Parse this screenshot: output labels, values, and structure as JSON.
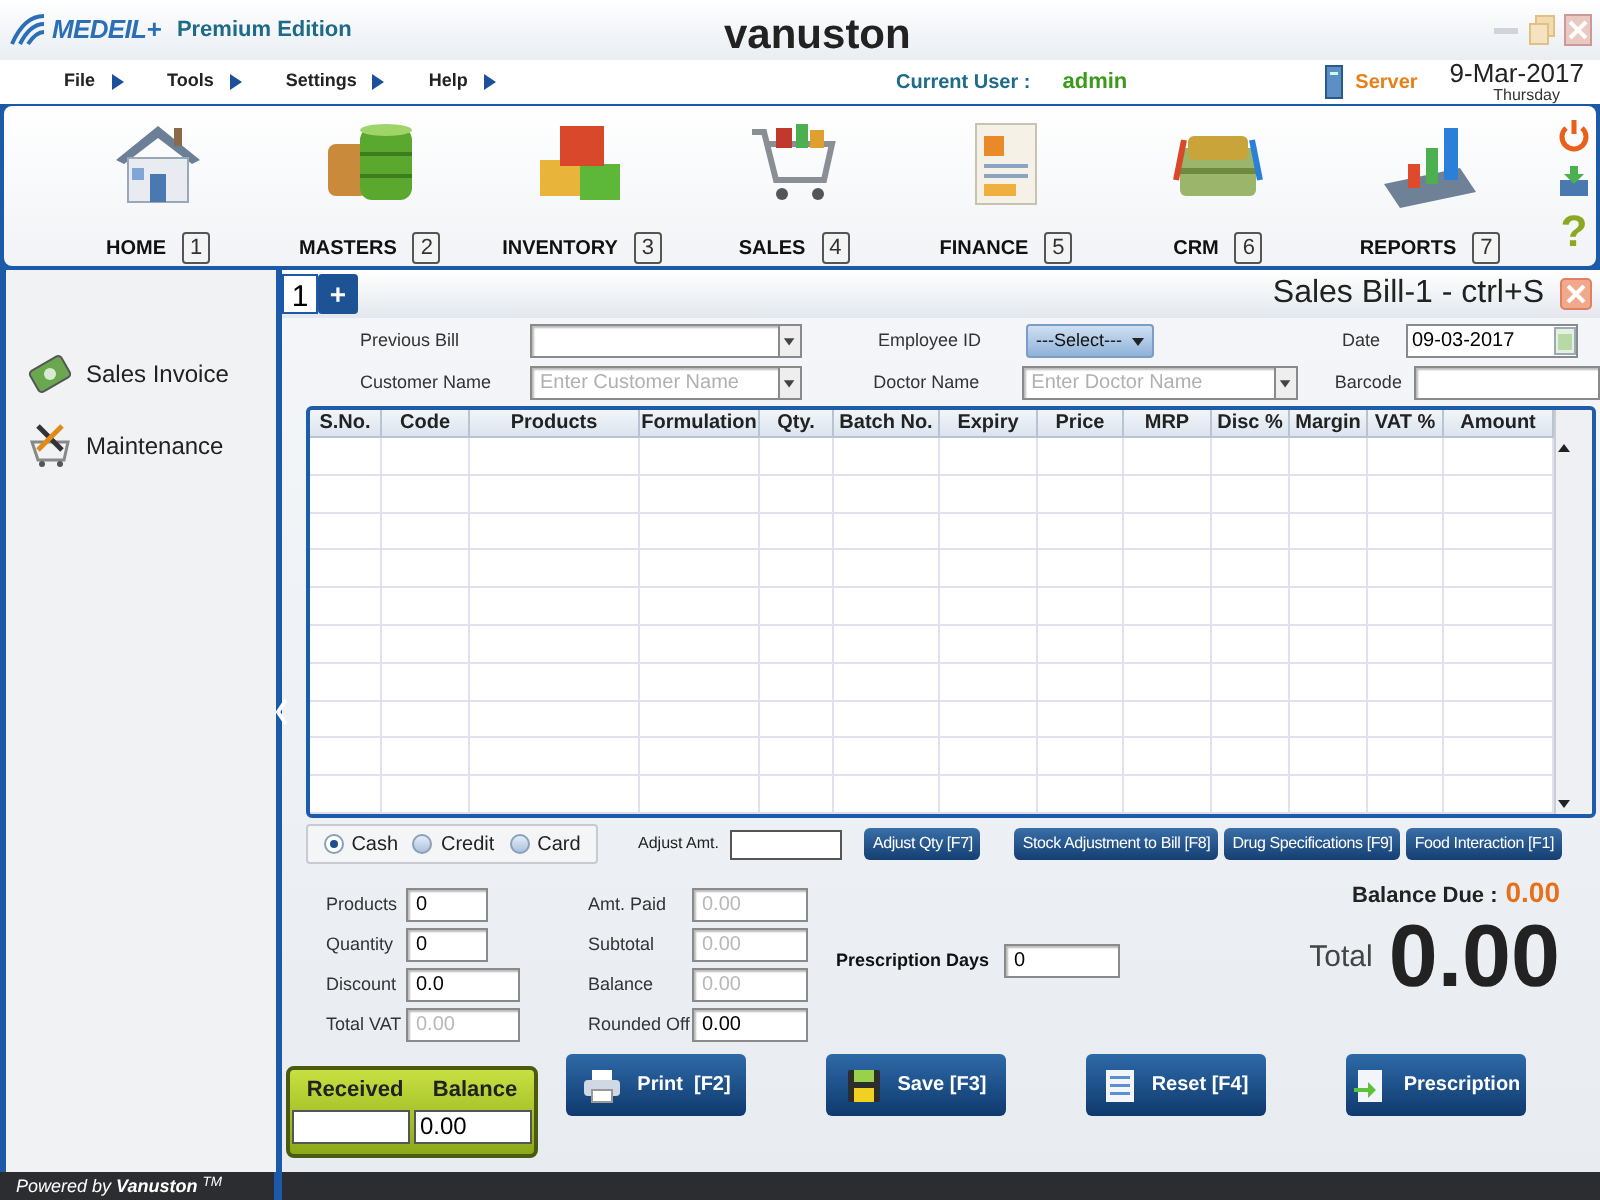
{
  "window": {
    "logo": "MEDEIL+",
    "edition": "Premium Edition",
    "title": "vanuston"
  },
  "menu": [
    {
      "label": "File"
    },
    {
      "label": "Tools"
    },
    {
      "label": "Settings"
    },
    {
      "label": "Help"
    }
  ],
  "user": {
    "label": "Current User :",
    "name": "admin"
  },
  "server": {
    "label": "Server"
  },
  "date": {
    "date": "9-Mar-2017",
    "day": "Thursday"
  },
  "toolbar": [
    {
      "label": "HOME",
      "key": "1"
    },
    {
      "label": "MASTERS",
      "key": "2"
    },
    {
      "label": "INVENTORY",
      "key": "3"
    },
    {
      "label": "SALES",
      "key": "4"
    },
    {
      "label": "FINANCE",
      "key": "5"
    },
    {
      "label": "CRM",
      "key": "6"
    },
    {
      "label": "REPORTS",
      "key": "7"
    }
  ],
  "help": {
    "label": "?"
  },
  "sidebar": {
    "items": [
      {
        "label": "Sales Invoice"
      },
      {
        "label": "Maintenance"
      }
    ]
  },
  "bill_tabs": [
    {
      "label": "1",
      "selected": true
    }
  ],
  "add_tab": {
    "label": "+"
  },
  "bill_title": "Sales Bill-1 - ctrl+S",
  "form": {
    "previous_bill": {
      "label": "Previous Bill"
    },
    "customer_name": {
      "label": "Customer Name",
      "placeholder": "Enter Customer Name"
    },
    "employee_id": {
      "label": "Employee ID",
      "value": "---Select---"
    },
    "doctor_name": {
      "label": "Doctor Name",
      "placeholder": "Enter Doctor Name"
    },
    "date": {
      "label": "Date",
      "value": "09-03-2017"
    },
    "barcode": {
      "label": "Barcode"
    }
  },
  "table": {
    "columns": [
      "S.No.",
      "Code",
      "Products",
      "Formulation",
      "Qty.",
      "Batch No.",
      "Expiry",
      "Price",
      "MRP",
      "Disc %",
      "Margin",
      "VAT %",
      "Amount"
    ]
  },
  "payment": [
    {
      "label": "Cash",
      "selected": true
    },
    {
      "label": "Credit",
      "selected": false
    },
    {
      "label": "Card",
      "selected": false
    }
  ],
  "adjust_amt": {
    "label": "Adjust Amt."
  },
  "actions": [
    "Adjust Qty [F7]",
    "Stock Adjustment to Bill [F8]",
    "Drug Specifications [F9]",
    "Food Interaction [F1]"
  ],
  "summary_left": [
    {
      "label": "Products",
      "value": "0",
      "disabled": false
    },
    {
      "label": "Quantity",
      "value": "0",
      "disabled": false
    },
    {
      "label": "Discount",
      "value": "0.0",
      "disabled": false
    },
    {
      "label": "Total VAT",
      "value": "0.00",
      "disabled": true
    }
  ],
  "summary_mid": [
    {
      "label": "Amt. Paid",
      "value": "0.00",
      "disabled": true
    },
    {
      "label": "Subtotal",
      "value": "0.00",
      "disabled": true
    },
    {
      "label": "Balance",
      "value": "0.00",
      "disabled": true
    },
    {
      "label": "Rounded Off",
      "value": "0.00",
      "disabled": false
    }
  ],
  "prescription_days": {
    "label": "Prescription Days",
    "value": "0"
  },
  "balance_due": {
    "label": "Balance Due :",
    "value": "0.00"
  },
  "total": {
    "label": "Total",
    "value": "0.00"
  },
  "received_box": {
    "received_label": "Received",
    "balance_label": "Balance",
    "balance_value": "0.00"
  },
  "bottom_buttons": [
    "Print  [F2]",
    "Save [F3]",
    "Reset [F4]",
    "Prescription"
  ],
  "footer": "Powered by **Vanuston** $^{TM}$"
}
